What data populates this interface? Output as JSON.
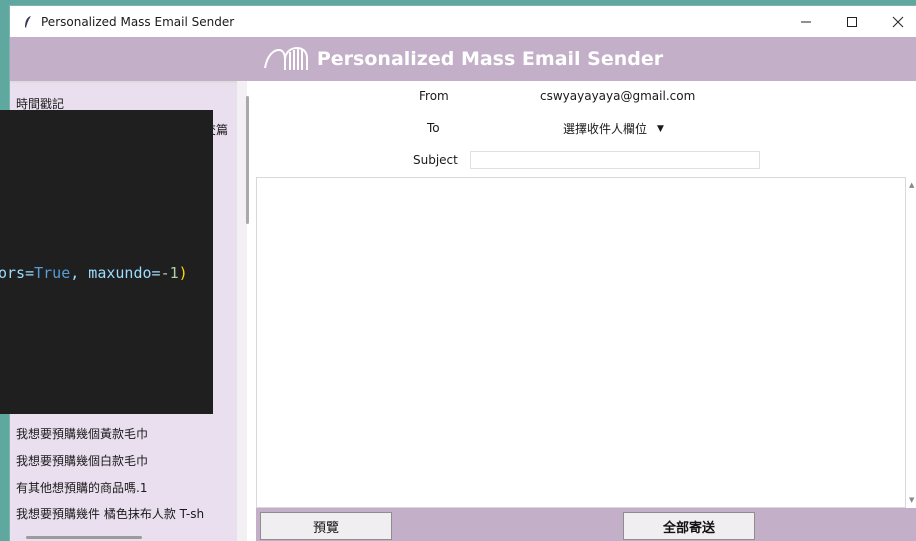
{
  "window": {
    "title": "Personalized Mass Email Sender",
    "controls": [
      "minimize-icon",
      "maximize-icon",
      "close-icon"
    ]
  },
  "banner": {
    "title": "Personalized Mass Email Sender",
    "logo_icon": "wave-logo-icon"
  },
  "left_panel": {
    "items": [
      {
        "label": "時間戳記"
      },
      {
        "label": "我想要預購幾個黃款毛巾"
      },
      {
        "label": "我想要預購幾個白款毛巾"
      },
      {
        "label": "有其他想預購的商品嗎.1"
      },
      {
        "label": "我想要預購幾件 橘色抹布人款  T-sh"
      }
    ],
    "partial_text": "交篇"
  },
  "form": {
    "from_label": "From",
    "from_value": "cswyayayaya@gmail.com",
    "to_label": "To",
    "to_select": "選擇收件人欄位",
    "subject_label": "Subject",
    "subject_value": ""
  },
  "buttons": {
    "preview": "預覽",
    "send_all": "全部寄送"
  },
  "code_overlay": {
    "text_a": "ors=",
    "text_b": "True",
    "text_c": ", maxundo=",
    "text_d": "-1",
    "text_e": ")"
  },
  "colors": {
    "accent": "#c3afc8",
    "panel": "#e9dfee",
    "desktop": "#5fa8a0"
  }
}
